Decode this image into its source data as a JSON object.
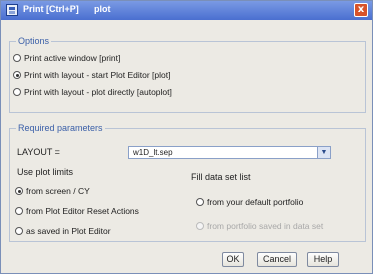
{
  "window": {
    "title": "Print [Ctrl+P]",
    "subtitle": "plot",
    "close_glyph": "x"
  },
  "options": {
    "legend": "Options",
    "items": [
      {
        "label": "Print active window [print]",
        "checked": false
      },
      {
        "label": "Print with layout - start Plot Editor [plot]",
        "checked": true
      },
      {
        "label": "Print with layout - plot directly [autoplot]",
        "checked": false
      }
    ]
  },
  "required": {
    "legend": "Required parameters",
    "layout_label": "LAYOUT =",
    "layout_value": "w1D_lt.sep",
    "use_limits_label": "Use plot limits",
    "limits_options": [
      {
        "label": "from screen / CY",
        "checked": true
      },
      {
        "label": "from Plot Editor Reset Actions",
        "checked": false
      },
      {
        "label": "as saved in Plot Editor",
        "checked": false
      }
    ],
    "fill_label": "Fill data set list",
    "fill_options": [
      {
        "label": "from your default portfolio",
        "checked": false,
        "disabled": false
      },
      {
        "label": "from portfolio saved in data set",
        "checked": false,
        "disabled": true
      }
    ]
  },
  "buttons": {
    "ok": "OK",
    "cancel": "Cancel",
    "help": "Help"
  },
  "icons": {
    "app": "print-dialog-icon",
    "dropdown": "chevron-down-icon"
  }
}
